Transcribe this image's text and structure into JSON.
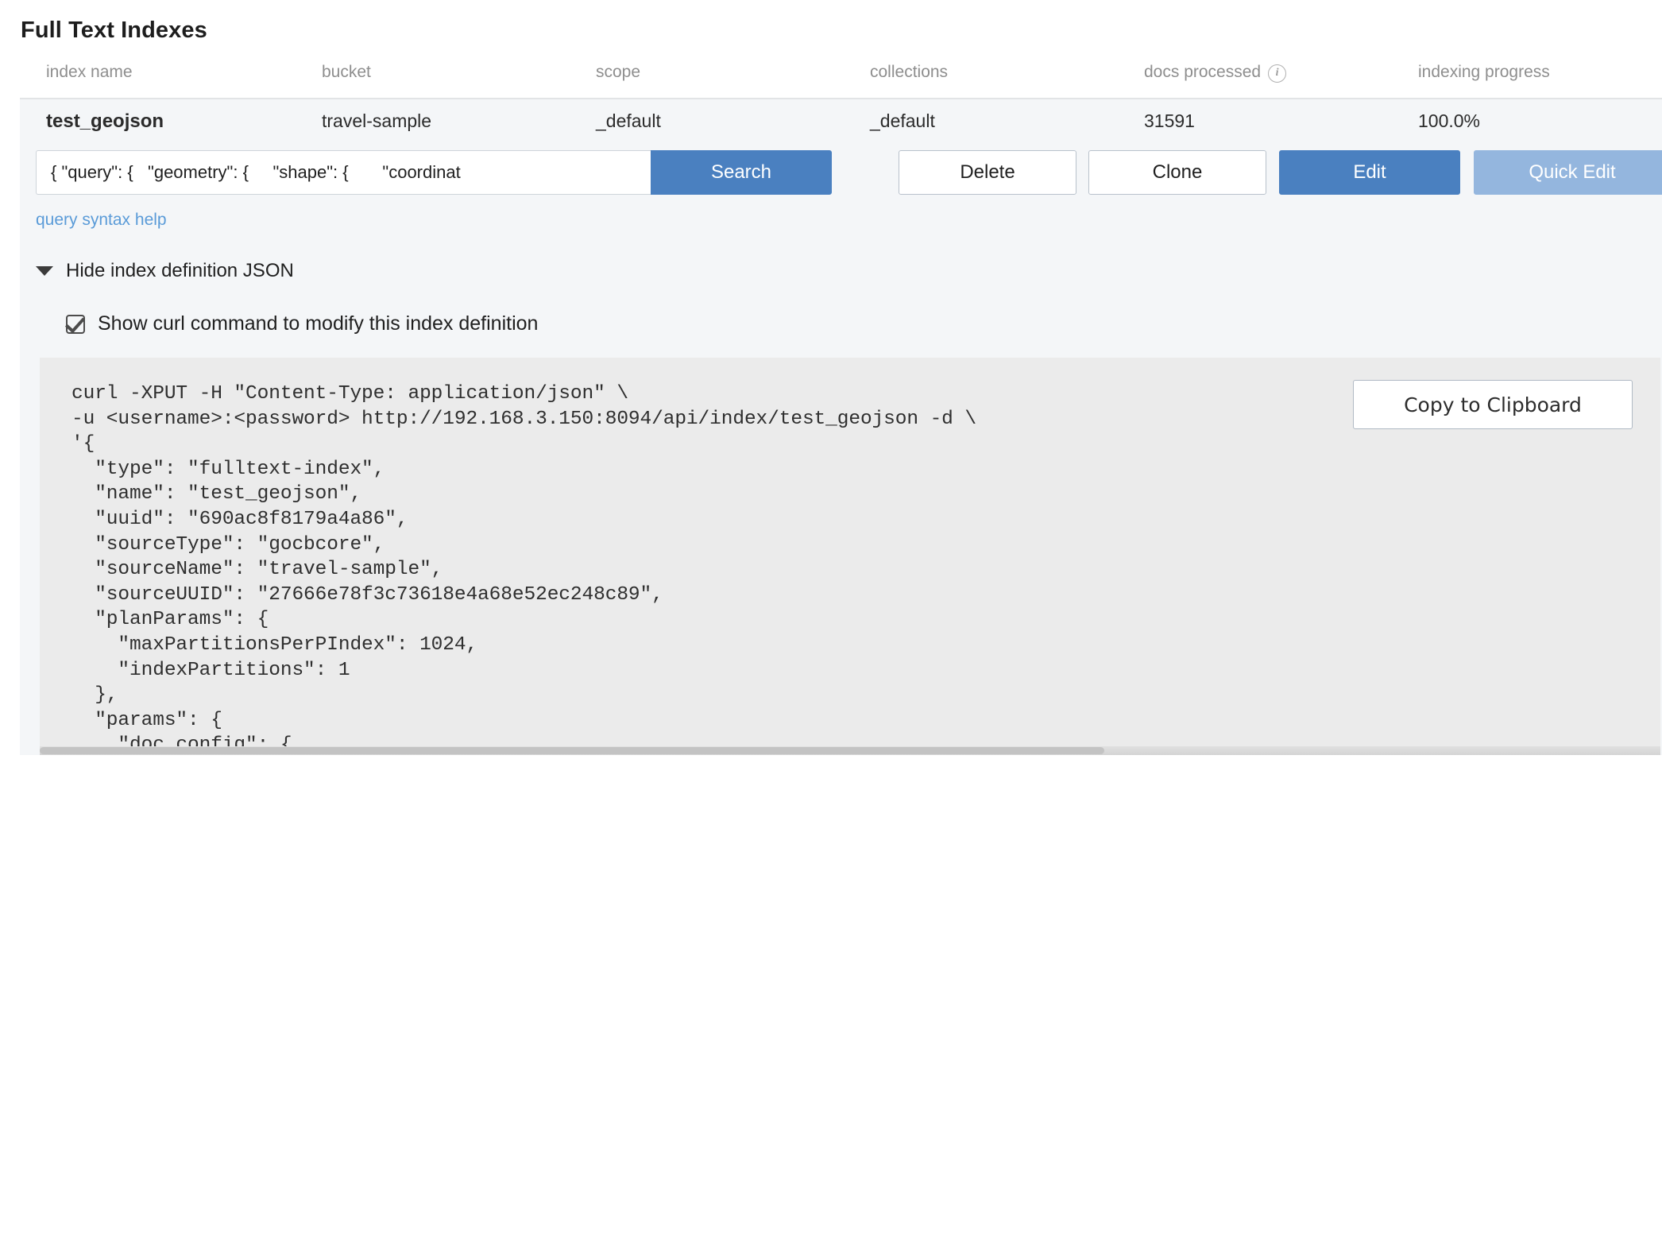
{
  "page_title": "Full Text Indexes",
  "table": {
    "headers": [
      {
        "label": "index name"
      },
      {
        "label": "bucket"
      },
      {
        "label": "scope"
      },
      {
        "label": "collections"
      },
      {
        "label": "docs processed",
        "icon": "info-icon",
        "icon_glyph": "i"
      },
      {
        "label": "indexing progress"
      }
    ],
    "row": {
      "index_name": "test_geojson",
      "bucket": "travel-sample",
      "scope": "_default",
      "collections": "_default",
      "docs_processed": "31591",
      "indexing_progress": "100.0%"
    }
  },
  "search": {
    "value": "{ \"query\": {   \"geometry\": {     \"shape\": {       \"coordinat",
    "placeholder": "",
    "button_label": "Search",
    "syntax_help_label": "query syntax help"
  },
  "actions": {
    "delete_label": "Delete",
    "clone_label": "Clone",
    "edit_label": "Edit",
    "quick_edit_label": "Quick Edit"
  },
  "disclosure": {
    "label": "Hide index definition JSON",
    "caret_icon": "caret-down-icon"
  },
  "curl_toggle": {
    "label": "Show curl command to modify this index definition",
    "checked": true
  },
  "code_block": {
    "copy_label": "Copy to Clipboard",
    "content": "curl -XPUT -H \"Content-Type: application/json\" \\\n-u <username>:<password> http://192.168.3.150:8094/api/index/test_geojson -d \\\n'{\n  \"type\": \"fulltext-index\",\n  \"name\": \"test_geojson\",\n  \"uuid\": \"690ac8f8179a4a86\",\n  \"sourceType\": \"gocbcore\",\n  \"sourceName\": \"travel-sample\",\n  \"sourceUUID\": \"27666e78f3c73618e4a68e52ec248c89\",\n  \"planParams\": {\n    \"maxPartitionsPerPIndex\": 1024,\n    \"indexPartitions\": 1\n  },\n  \"params\": {\n    \"doc_config\": {\n      \"docid_prefix_delim\": \"\",\n      \"docid_regexp\": \"\",\n      \"mode\": \"scope.collection.type_field\",\n      \"type_field\": \"type\"\n    },\n    \"mapping\": {\n      \"analysis\": {},\n      \"default_analyzer\": \"standard\",\n      \"default_datetime_parser\": \"dateTimeOptional\","
  },
  "colors": {
    "accent_blue": "#4a80c0",
    "accent_blue_disabled": "#94b6de",
    "link_blue": "#5a9bd8",
    "panel_bg": "#f4f6f8",
    "code_bg": "#ebebeb"
  }
}
